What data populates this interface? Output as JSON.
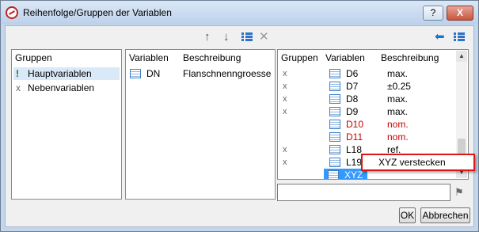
{
  "window": {
    "title": "Reihenfolge/Gruppen der Variablen"
  },
  "titlebar": {
    "help_label": "?",
    "close_label": "X"
  },
  "toolbar_middle": {
    "move_up_icon": "arrow-up",
    "move_down_icon": "arrow-down",
    "list_icon": "list-grid",
    "delete_icon": "delete-x",
    "up_glyph": "↑",
    "down_glyph": "↓",
    "delete_glyph": "✕"
  },
  "toolbar_right": {
    "back_icon": "arrow-left",
    "list_icon": "list-grid",
    "back_glyph": "⬅"
  },
  "groups_panel": {
    "header": "Gruppen",
    "items": [
      {
        "label": "Hauptvariablen",
        "marker": "!",
        "selected": true
      },
      {
        "label": "Nebenvariablen",
        "marker": "x",
        "selected": false
      }
    ]
  },
  "vars_panel": {
    "headers": [
      "Variablen",
      "Beschreibung"
    ],
    "rows": [
      {
        "name": "DN",
        "desc": "Flanschnenngroesse"
      }
    ]
  },
  "right_panel": {
    "headers": [
      "Gruppen",
      "Variablen",
      "Beschreibung"
    ],
    "rows": [
      {
        "group": "x",
        "name": "D6",
        "desc": "max.",
        "color": "#000000"
      },
      {
        "group": "x",
        "name": "D7",
        "desc": "±0.25",
        "color": "#000000"
      },
      {
        "group": "x",
        "name": "D8",
        "desc": "max.",
        "color": "#000000"
      },
      {
        "group": "x",
        "name": "D9",
        "desc": "max.",
        "color": "#000000"
      },
      {
        "group": "",
        "name": "D10",
        "desc": "nom.",
        "color": "#cc0000"
      },
      {
        "group": "",
        "name": "D11",
        "desc": "nom.",
        "color": "#cc0000"
      },
      {
        "group": "x",
        "name": "L18",
        "desc": "ref.",
        "color": "#000000"
      },
      {
        "group": "x",
        "name": "L19",
        "desc": "",
        "color": "#000000"
      },
      {
        "group": "",
        "name": "XYZ",
        "desc": "",
        "color": "#ffffff",
        "selected": true
      }
    ]
  },
  "context_menu": {
    "item": "XYZ verstecken"
  },
  "search": {
    "value": ""
  },
  "buttons": {
    "ok": "OK",
    "cancel": "Abbrechen"
  },
  "colors": {
    "selection": "#3399ff",
    "highlight_border": "#e01616",
    "red_text": "#cc0000"
  }
}
